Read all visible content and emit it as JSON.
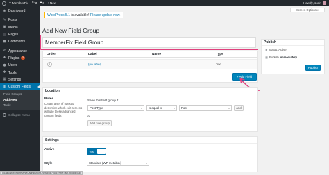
{
  "adminbar": {
    "site_name": "MemberFix",
    "updates_count": "3",
    "comments_count": "0",
    "new_label": "+ New",
    "greeting": "Howdy, sorin"
  },
  "sidebar": {
    "items": [
      {
        "label": "Dashboard",
        "icon": "dashboard-icon",
        "glyph": "◉"
      },
      {
        "label": "Posts",
        "icon": "pin-icon",
        "glyph": "✎"
      },
      {
        "label": "Media",
        "icon": "media-icon",
        "glyph": "▣"
      },
      {
        "label": "Pages",
        "icon": "page-icon",
        "glyph": "▤"
      },
      {
        "label": "Comments",
        "icon": "comment-icon",
        "glyph": "◼"
      },
      {
        "label": "Appearance",
        "icon": "brush-icon",
        "glyph": "✐"
      },
      {
        "label": "Plugins",
        "icon": "plugin-icon",
        "glyph": "✚",
        "badge": "3"
      },
      {
        "label": "Users",
        "icon": "user-icon",
        "glyph": "●"
      },
      {
        "label": "Tools",
        "icon": "wrench-icon",
        "glyph": "✱"
      },
      {
        "label": "Settings",
        "icon": "settings-icon",
        "glyph": "▦"
      },
      {
        "label": "Custom Fields",
        "icon": "fields-icon",
        "glyph": "▥"
      }
    ],
    "submenu": [
      "Field Groups",
      "Add New",
      "Tools"
    ],
    "collapse_label": "Collapse menu"
  },
  "screen_options": "Screen Options",
  "notice": {
    "version_link": "WordPress 5.1",
    "text": " is available! ",
    "update_link": "Please update now."
  },
  "page_title": "Add New Field Group",
  "title_input_value": "MemberFix Field Group",
  "fields_table": {
    "headers": [
      "Order",
      "Label",
      "Name",
      "Type"
    ],
    "row": {
      "order": "1",
      "label": "(no label)",
      "name": "",
      "type": "Text"
    },
    "add_field_label": "+ Add Field"
  },
  "location": {
    "title": "Location",
    "rules_label": "Rules",
    "rules_desc": "Create a set of rules to determine which edit screens will use these advanced custom fields",
    "show_if_label": "Show this field group if",
    "param_select": "Post Type",
    "operator_select": "is equal to",
    "value_select": "Post",
    "and_label": "and",
    "or_label": "or",
    "add_rule_group_label": "Add rule group"
  },
  "settings": {
    "title": "Settings",
    "active_label": "Active",
    "toggle_label": "Yes",
    "style_label": "Style",
    "style_select": "Standard (WP metabox)"
  },
  "publish": {
    "title": "Publish",
    "status_text": "Status: Active",
    "publish_text_prefix": "Publish",
    "publish_text_value": "immediately",
    "button_label": "Publish"
  },
  "status_url": "localhost/wordpress/wp-admin/post-new.php?post_type=acf-field-group",
  "colors": {
    "accent": "#0073aa",
    "highlight": "#e0407d",
    "adminbar": "#23282d"
  }
}
